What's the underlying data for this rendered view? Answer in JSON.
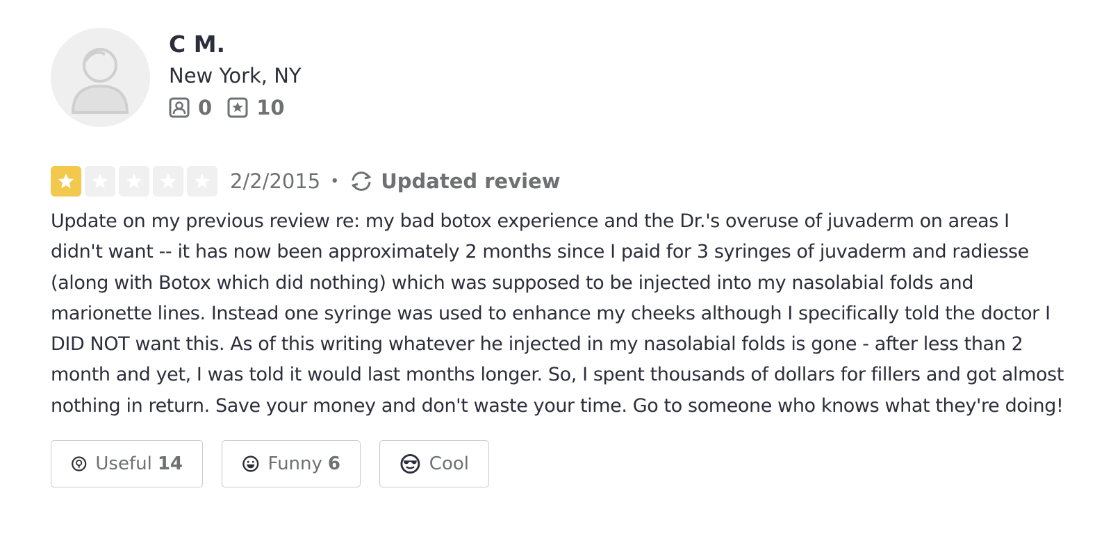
{
  "user": {
    "name": "C M.",
    "location": "New York, NY",
    "friends_count": "0",
    "reviews_count": "10"
  },
  "review": {
    "rating": 1,
    "max_rating": 5,
    "date": "2/2/2015",
    "separator": "•",
    "updated_label": "Updated review",
    "text": "Update on my previous review re: my bad botox experience and the Dr.'s overuse of juvaderm on areas I didn't want -- it has now been approximately 2 months since I paid for 3 syringes of juvaderm and radiesse (along with Botox which did nothing) which was supposed to be injected into my nasolabial folds and marionette lines. Instead one syringe was used to enhance my cheeks although I specifically told the doctor I DID NOT want this. As of this writing whatever he injected in my nasolabial folds is gone - after less than 2 month and yet, I was told it would last months longer. So, I spent thousands of dollars for fillers and got almost nothing in return. Save your money and don't waste your time. Go to someone who knows what they're doing!"
  },
  "reactions": {
    "useful_label": "Useful",
    "useful_count": "14",
    "funny_label": "Funny",
    "funny_count": "6",
    "cool_label": "Cool"
  },
  "colors": {
    "star_filled": "#f2c94c",
    "star_empty": "#f0f0f0",
    "text": "#2d2e3b",
    "muted": "#6e7072"
  }
}
